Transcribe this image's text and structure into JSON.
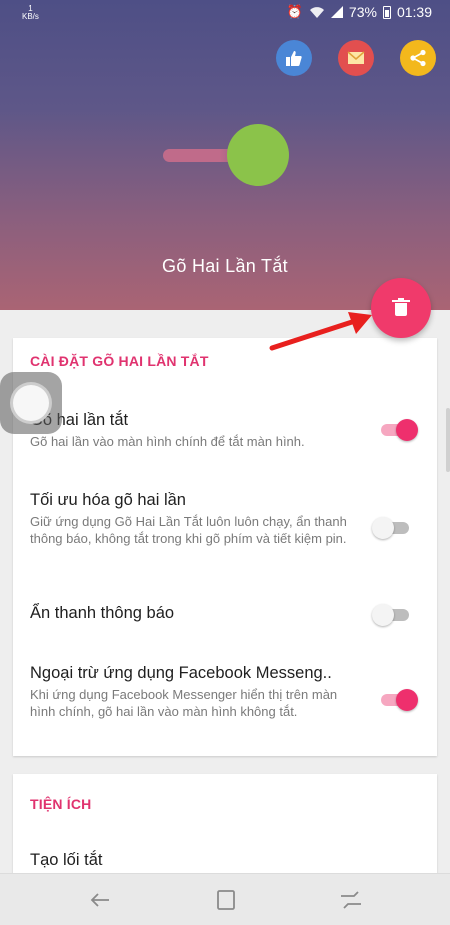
{
  "status_bar": {
    "speed_value": "1",
    "speed_unit": "KB/s",
    "alarm_icon": "alarm-icon",
    "wifi_icon": "wifi-icon",
    "signal_icon": "signal-icon",
    "battery_percent": "73%",
    "time": "01:39"
  },
  "header": {
    "app_title": "Gõ Hai Lần Tắt",
    "actions": [
      {
        "icon": "thumbs-up-icon",
        "color": "#4a86d6"
      },
      {
        "icon": "mail-icon",
        "color": "#e24f4f"
      },
      {
        "icon": "share-icon",
        "color": "#f3b81c"
      }
    ],
    "illustration": {
      "track_color": "#c06b8a",
      "knob_color": "#8bc34a"
    }
  },
  "fab": {
    "icon": "trash-icon",
    "color": "#f03a6b"
  },
  "settings_section": {
    "title": "CÀI ĐẶT GÕ HAI LẦN TẮT",
    "items": [
      {
        "title": "Gõ hai lần tắt",
        "description": "Gõ hai lần vào màn hình chính để tắt màn hình.",
        "enabled": true
      },
      {
        "title": "Tối ưu hóa gõ hai lần",
        "description": "Giữ ứng dụng Gõ Hai Lần Tắt luôn luôn chạy, ẩn thanh thông báo, không tắt trong khi gõ phím và tiết kiệm pin.",
        "enabled": false
      },
      {
        "title": "Ẩn thanh thông báo",
        "description": "",
        "enabled": false
      },
      {
        "title": "Ngoại trừ ứng dụng Facebook Messeng..",
        "description": "Khi ứng dụng Facebook Messenger hiển thị trên màn hình chính, gõ hai lần vào màn hình không tắt.",
        "enabled": true
      }
    ]
  },
  "utilities_section": {
    "title": "TIỆN ÍCH",
    "items": [
      {
        "title": "Tạo lối tắt"
      }
    ]
  },
  "colors": {
    "accent": "#ee2f6d",
    "switch_on_track": "#f6a7c0",
    "annotation_arrow": "#e8201e"
  },
  "nav_bar": {
    "back_icon": "back-icon",
    "recent_icon": "recent-apps-icon",
    "home_icon": "home-icon"
  }
}
